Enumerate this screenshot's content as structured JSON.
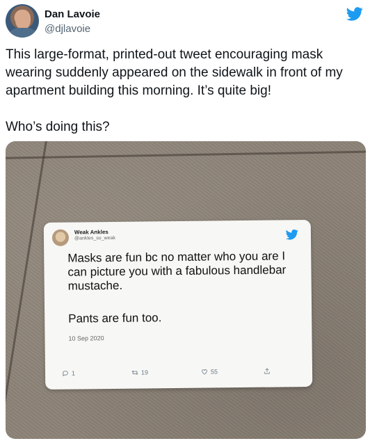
{
  "author": {
    "display_name": "Dan Lavoie",
    "handle": "@djlavoie",
    "avatar_icon": "person-avatar"
  },
  "brand_icon": "twitter-bird-icon",
  "brand_color": "#1d9bf0",
  "tweet": {
    "paragraph1": "This large-format, printed-out tweet encouraging mask wearing suddenly appeared on the sidewalk in front of my apartment building this morning. It’s quite big!",
    "paragraph2": "Who’s doing this?"
  },
  "photo": {
    "poster": {
      "display_name": "Weak Ankles",
      "handle": "@ankles_so_weak",
      "text1": "Masks are fun bc no matter who you are I can picture you with a fabulous handlebar mustache.",
      "text2": "Pants are fun too.",
      "date": "10 Sep 2020",
      "replies": "1",
      "retweets": "19",
      "likes": "55"
    }
  }
}
